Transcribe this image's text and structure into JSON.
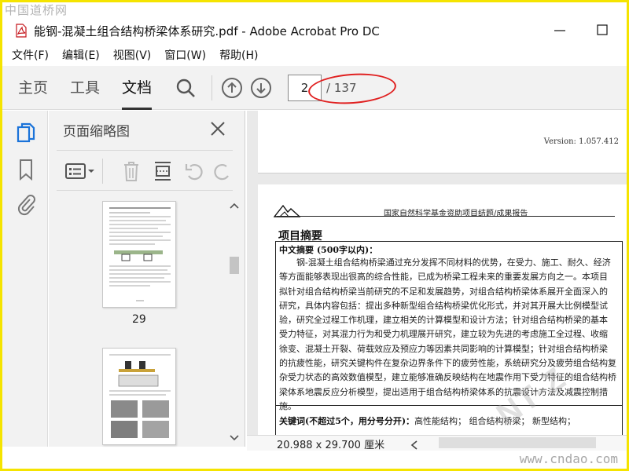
{
  "watermarks": {
    "top_left": "中国道桥网",
    "bottom_right": "www.cndao.com"
  },
  "window": {
    "title": "能钢-混凝土组合结构桥梁体系研究.pdf - Adobe Acrobat Pro DC"
  },
  "menu": [
    "文件(F)",
    "编辑(E)",
    "视图(V)",
    "窗口(W)",
    "帮助(H)"
  ],
  "toolbar": {
    "tabs": [
      "主页",
      "工具",
      "文档"
    ],
    "active_tab": "文档",
    "current_page": "2",
    "total_pages": "/ 137",
    "highlight_color": "#e02020"
  },
  "thumbnail_panel": {
    "title": "页面缩略图",
    "thumbnails": [
      {
        "page_label": "29"
      }
    ]
  },
  "document": {
    "version_text": "Version: 1.057.412",
    "report_caption": "国家自然科学基金资助项目结题/成果报告",
    "section_title": "项目摘要",
    "abstract_heading": "中文摘要 (500字以内)：",
    "abstract_lines": [
      "钢-混凝土组合结构桥梁通过充分发挥不同材料的优势，在受力、施工、耐久、经济",
      "等方面能够表现出很高的综合性能，已成为桥梁工程未来的重要发展方向之一。本项目",
      "拟针对组合结构桥梁当前研究的不足和发展趋势，对组合结构桥梁体系展开全面深入的",
      "研究，具体内容包括：提出多种新型组合结构桥梁优化形式，并对其开展大比例模型试",
      "验，研究全过程工作机理，建立相关的计算模型和设计方法；针对组合结构桥梁的基本",
      "受力特征，对其混力行为和受力机理展开研究，建立较为先进的考虑施工全过程、收缩",
      "徐变、混凝土开裂、荷载效应及预应力等因素共同影响的计算模型；针对组合结构桥梁",
      "的抗疲性能，研究关键构件在复杂边界条件下的疲劳性能，系统研究分及疲劳组合结构复",
      "杂受力状态的高效数值模型，建立能够准确反映结构在地震作用下受力特征的组合结构桥",
      "梁体系地震反应分析模型，提出适用于组合结构桥梁体系的抗震设计方法及减震控制措",
      "施。"
    ],
    "keywords_heading": "关键词(不超过5个，用分号分开)：",
    "keywords_text": "高性能结构；  组合结构桥梁；  新型结构；",
    "stamp_text": "NT-Z"
  },
  "statusbar": {
    "page_size": "20.988 x 29.700 厘米"
  }
}
